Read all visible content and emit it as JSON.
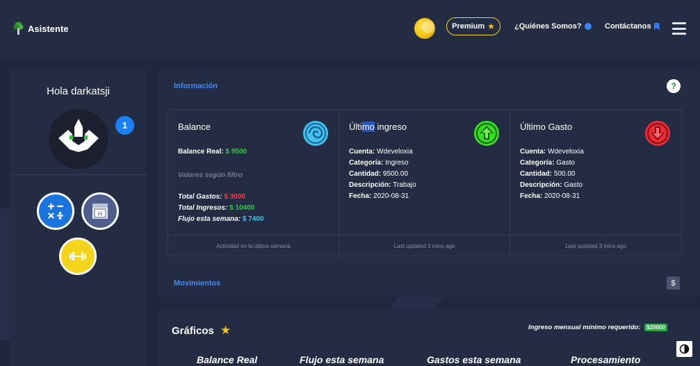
{
  "navbar": {
    "brand": "Asistente",
    "premium_label": "Premium",
    "about_label": "¿Quiénes Somos?",
    "contact_label": "Contáctanos"
  },
  "sidebar": {
    "greeting": "Hola darkatsji",
    "notification_count": "1",
    "tools": [
      "calculator-icon",
      "calendar-icon",
      "dumbbell-icon"
    ]
  },
  "info": {
    "title": "Información",
    "help": "?",
    "balance": {
      "title": "Balance",
      "real_label": "Balance Real:",
      "real_value": "$ 9500",
      "filter_note": "Valores según filtro",
      "gastos_label": "Total Gastos:",
      "gastos_value": "$ 3000",
      "ingresos_label": "Total Ingresos:",
      "ingresos_value": "$ 10400",
      "flujo_label": "Flujo esta semana:",
      "flujo_value": "$ 7400",
      "footer": "Actividad en la última semana"
    },
    "ingreso": {
      "title_pre": "Últi",
      "title_hl": "mo",
      "title_post": " ingreso",
      "cuenta_label": "Cuenta:",
      "cuenta": " Wdeveloxia",
      "categoria_label": "Categoría:",
      "categoria": " Ingreso",
      "cantidad_label": "Cantidad:",
      "cantidad": " 9500.00",
      "descripcion_label": "Descripción:",
      "descripcion": " Trabajo",
      "fecha_label": "Fecha:",
      "fecha": " 2020-08-31",
      "footer": "Last updated 3 mins ago"
    },
    "gasto": {
      "title": "Último Gasto",
      "cuenta_label": "Cuenta:",
      "cuenta": " Wdeveloxia",
      "categoria_label": "Categoría:",
      "categoria": " Gasto",
      "cantidad_label": "Cantidad:",
      "cantidad": " 500.00",
      "descripcion_label": "Descripción:",
      "descripcion": " Gasto",
      "fecha_label": "Fecha:",
      "fecha": " 2020-08-31",
      "footer": "Last updated 3 mins ago"
    },
    "movimientos_title": "Movimientos",
    "movimientos_icon": "$"
  },
  "graficos": {
    "title": "Gráficos",
    "requirement_label": "Ingreso mensual mínimo requerido:",
    "requirement_value": "$20000",
    "charts": [
      "Balance Real",
      "Flujo esta semana",
      "Gastos esta semana",
      "Procesamiento"
    ]
  },
  "colors": {
    "background": "#1f263d",
    "card": "#242c44",
    "accent_blue": "#3d8bfd",
    "positive": "#2ecc40",
    "negative": "#ff3344",
    "flow": "#3cc7e8",
    "premium": "#f5d416"
  }
}
